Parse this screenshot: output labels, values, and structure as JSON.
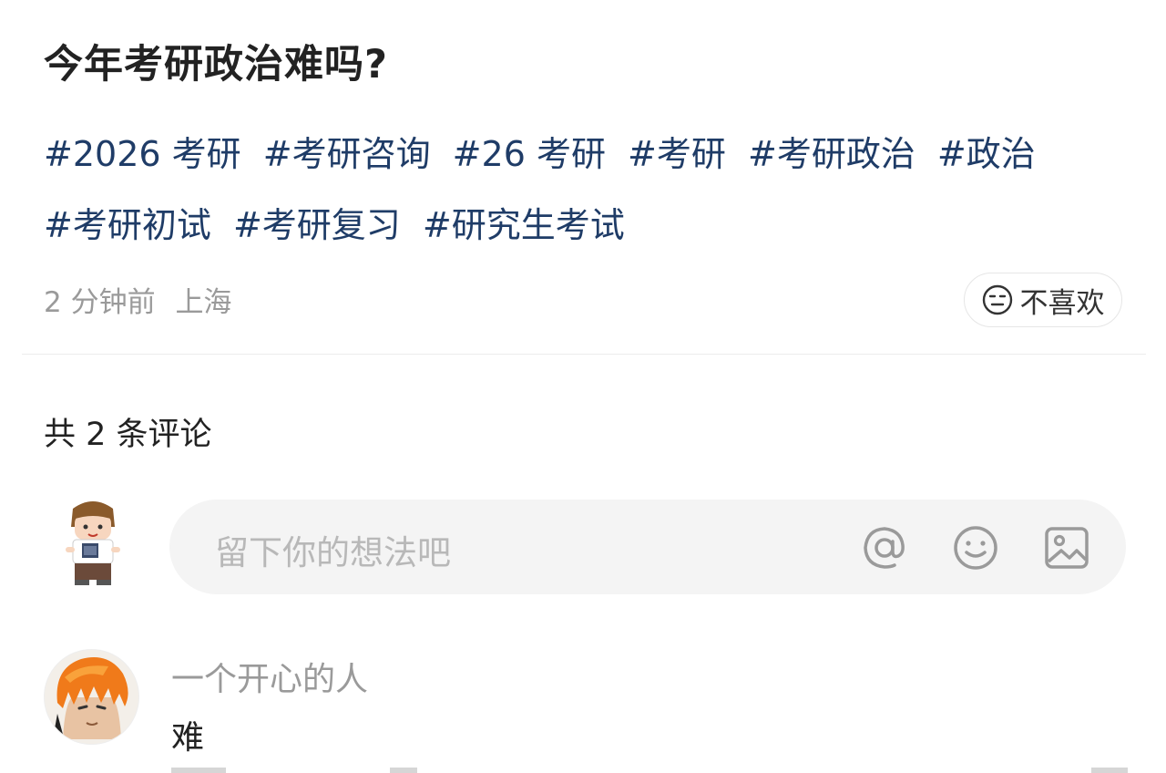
{
  "post": {
    "title": "今年考研政治难吗?",
    "tags": [
      "#2026 考研",
      "#考研咨询",
      "#26 考研",
      "#考研",
      "#考研政治",
      "#政治",
      "#考研初试",
      "#考研复习",
      "#研究生考试"
    ],
    "time": "2 分钟前",
    "location": "上海",
    "dislike_label": "不喜欢",
    "dislike_icon": "neutral-face-icon"
  },
  "comments": {
    "count_label": "共 2 条评论",
    "input": {
      "placeholder": "留下你的想法吧",
      "icons": [
        "at-icon",
        "emoji-icon",
        "image-icon"
      ]
    },
    "items": [
      {
        "username": "一个开心的人",
        "text": "难"
      }
    ]
  },
  "colors": {
    "tag": "#1f3c67",
    "muted": "#9a9a9a",
    "input_bg": "#f4f4f4"
  }
}
